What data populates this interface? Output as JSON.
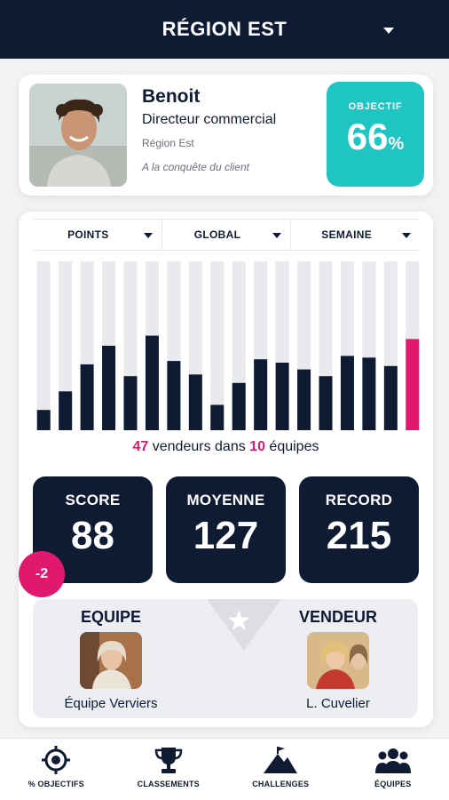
{
  "header": {
    "title": "RÉGION EST"
  },
  "profile": {
    "name": "Benoit",
    "role": "Directeur commercial",
    "region": "Région Est",
    "motto": "A la conquête du client",
    "objective_label": "OBJECTIF",
    "objective_value": "66",
    "objective_unit": "%"
  },
  "filters": [
    {
      "label": "POINTS"
    },
    {
      "label": "GLOBAL"
    },
    {
      "label": "SEMAINE"
    }
  ],
  "chart_data": {
    "type": "bar",
    "ylim": [
      0,
      100
    ],
    "grid": false,
    "values": [
      12,
      23,
      39,
      50,
      32,
      56,
      41,
      33,
      15,
      28,
      42,
      40,
      36,
      32,
      44,
      43,
      38,
      54
    ],
    "highlight_index": 17,
    "colors": {
      "bar": "#0f1a33",
      "track": "#e9eaee",
      "highlight": "#e0196f"
    }
  },
  "summary": {
    "sellers": "47",
    "sellers_text": " vendeurs dans ",
    "teams": "10",
    "teams_text": " équipes"
  },
  "kpis": {
    "score_label": "SCORE",
    "score_value": "88",
    "average_label": "MOYENNE",
    "average_value": "127",
    "record_label": "RECORD",
    "record_value": "215",
    "delta": "-2"
  },
  "best": {
    "team_title": "EQUIPE",
    "team_name": "Équipe Verviers",
    "seller_title": "VENDEUR",
    "seller_name": "L. Cuvelier"
  },
  "nav": [
    {
      "label": "% OBJECTIFS",
      "icon": "target-icon"
    },
    {
      "label": "CLASSEMENTS",
      "icon": "trophy-icon"
    },
    {
      "label": "CHALLENGES",
      "icon": "mountain-flag-icon"
    },
    {
      "label": "ÉQUIPES",
      "icon": "team-icon"
    }
  ],
  "colors": {
    "navy": "#0f1a33",
    "teal": "#1fc5c3",
    "pink": "#e0196f"
  }
}
